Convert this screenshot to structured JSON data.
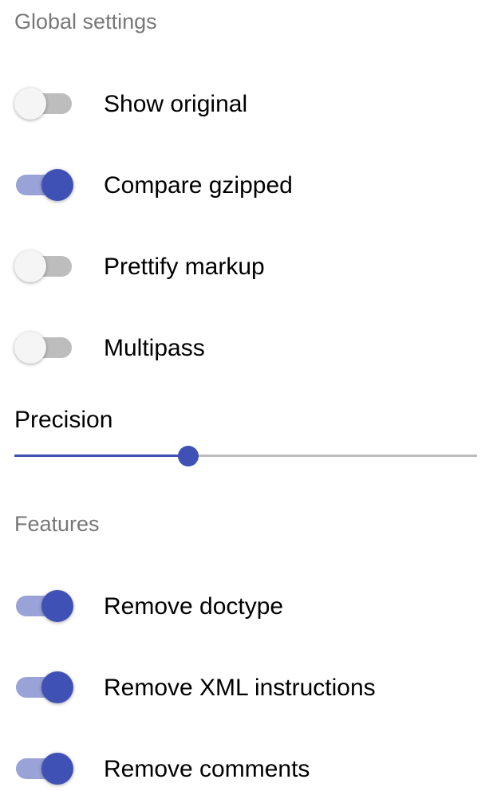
{
  "global_settings": {
    "title": "Global settings",
    "toggles": [
      {
        "label": "Show original",
        "on": false
      },
      {
        "label": "Compare gzipped",
        "on": true
      },
      {
        "label": "Prettify markup",
        "on": false
      },
      {
        "label": "Multipass",
        "on": false
      }
    ],
    "precision": {
      "label": "Precision",
      "value_fraction": 0.375
    }
  },
  "features": {
    "title": "Features",
    "toggles": [
      {
        "label": "Remove doctype",
        "on": true
      },
      {
        "label": "Remove XML instructions",
        "on": true
      },
      {
        "label": "Remove comments",
        "on": true
      }
    ]
  },
  "colors": {
    "accent": "#3f51b5",
    "accent_track": "#9aa3d8",
    "off_track": "#bdbdbd",
    "section_title": "#777777"
  }
}
